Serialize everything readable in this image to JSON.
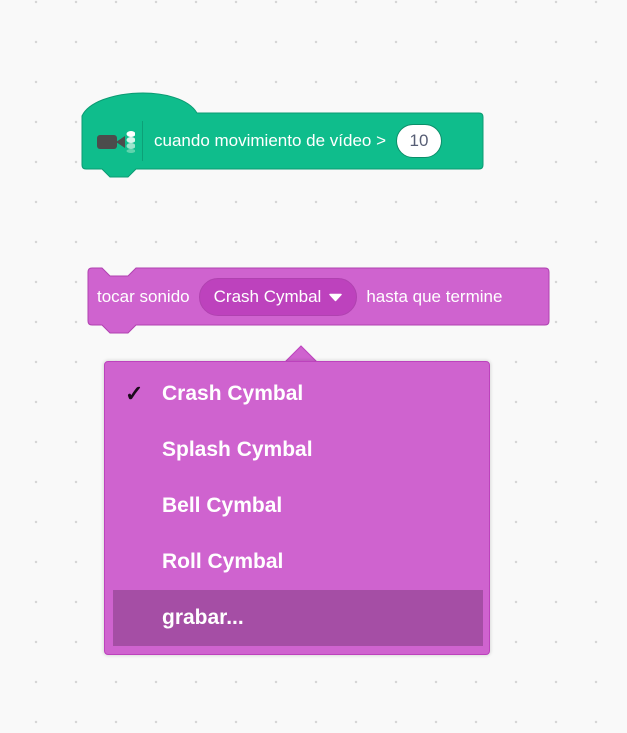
{
  "hat_block": {
    "extension_icon": "video-sensing-icon",
    "text": "cuando movimiento de vídeo >",
    "value": "10",
    "color": "#0fbd8c"
  },
  "sound_block": {
    "text_before": "tocar sonido",
    "selected_sound": "Crash Cymbal",
    "text_after": "hasta que termine",
    "color": "#cf63cf"
  },
  "dropdown_menu": {
    "selected_index": 0,
    "check_mark": "✓",
    "items": [
      {
        "label": "Crash Cymbal"
      },
      {
        "label": "Splash Cymbal"
      },
      {
        "label": "Bell Cymbal"
      },
      {
        "label": "Roll Cymbal"
      },
      {
        "label": "grabar..."
      }
    ],
    "highlighted_index": 4
  }
}
